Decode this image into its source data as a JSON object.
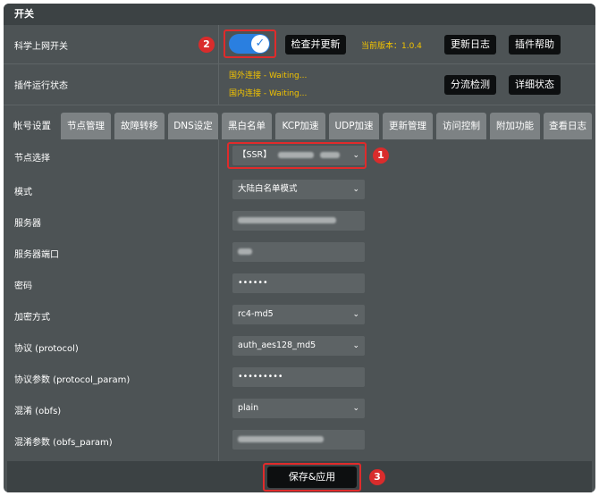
{
  "title": "开关",
  "main_switch": {
    "label": "科学上网开关",
    "toggle_state": "on",
    "check_update_button": "检查并更新",
    "version_text": "当前版本：1.0.4",
    "changelog_button": "更新日志",
    "plugin_help_button": "插件帮助",
    "badge": "2"
  },
  "status": {
    "label": "插件运行状态",
    "foreign": "国外连接 - Waiting...",
    "domestic": "国内连接 - Waiting...",
    "split_check_button": "分流检测",
    "detail_status_button": "详细状态"
  },
  "tabs": [
    "帐号设置",
    "节点管理",
    "故障转移",
    "DNS设定",
    "黑白名单",
    "KCP加速",
    "UDP加速",
    "更新管理",
    "访问控制",
    "附加功能",
    "查看日志"
  ],
  "fields": [
    {
      "label": "节点选择",
      "value": "【SSR】",
      "type": "select",
      "badge": "1"
    },
    {
      "label": "模式",
      "value": "大陆白名单模式",
      "type": "select"
    },
    {
      "label": "服务器",
      "value": "",
      "type": "text"
    },
    {
      "label": "服务器端口",
      "value": "",
      "type": "text"
    },
    {
      "label": "密码",
      "value": "••••••",
      "type": "text"
    },
    {
      "label": "加密方式",
      "value": "rc4-md5",
      "type": "select"
    },
    {
      "label": "协议 (protocol)",
      "value": "auth_aes128_md5",
      "type": "select"
    },
    {
      "label": "协议参数 (protocol_param)",
      "value": "•••••••••",
      "type": "text"
    },
    {
      "label": "混淆 (obfs)",
      "value": "plain",
      "type": "select"
    },
    {
      "label": "混淆参数 (obfs_param)",
      "value": "",
      "type": "text"
    }
  ],
  "save_button": "保存&应用",
  "save_badge": "3",
  "colors": {
    "panel": "#4d5355",
    "accent": "#2a7fe0",
    "highlight": "#e02b2b",
    "status": "#f2c300"
  }
}
